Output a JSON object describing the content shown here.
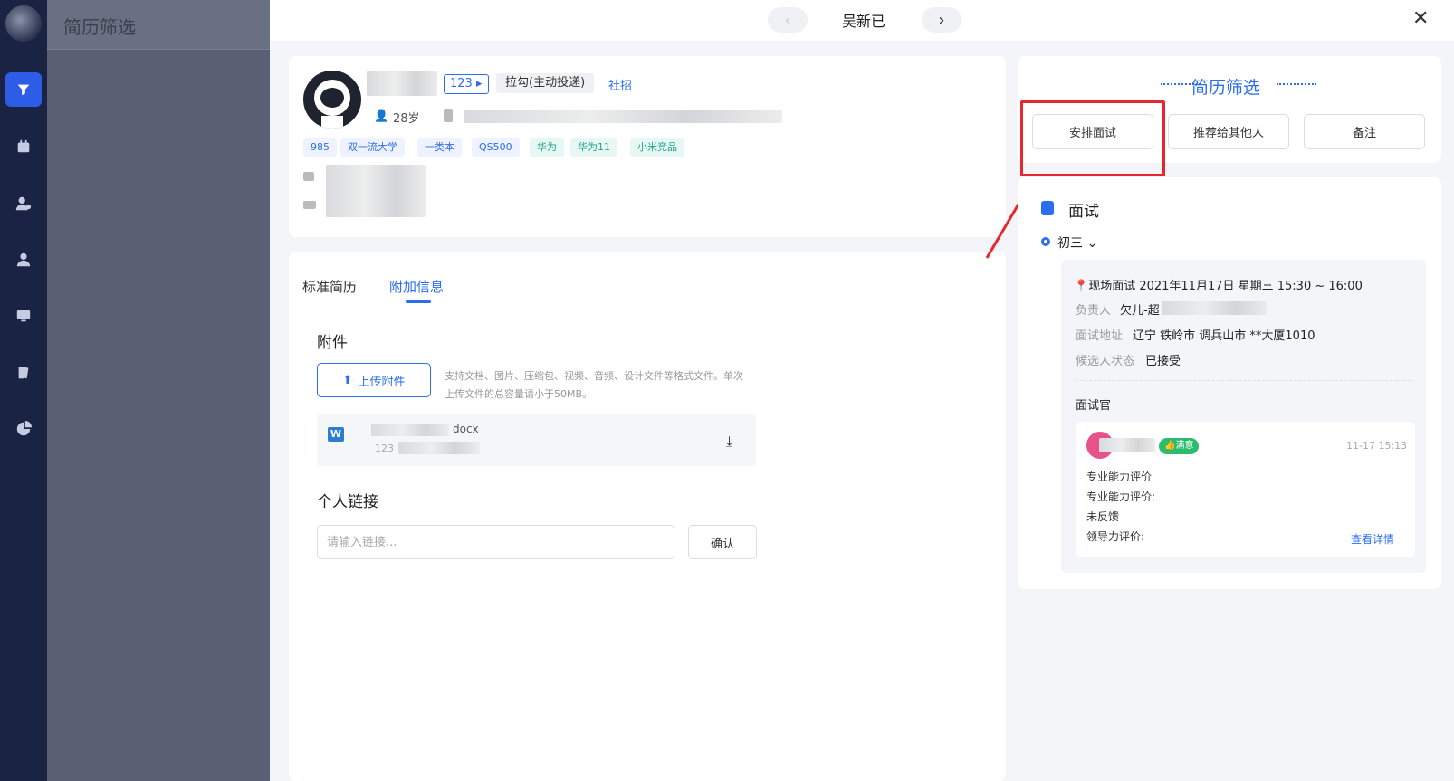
{
  "underlay": {
    "title": "简历筛选"
  },
  "header": {
    "candidate_name": "吴新已",
    "prev": "‹",
    "next": "›",
    "close": "✕"
  },
  "profile": {
    "id_tag": "123",
    "source": "拉勾(主动投递)",
    "type": "社招",
    "age": "28岁",
    "tags": [
      {
        "label": "985",
        "color": "blue"
      },
      {
        "label": "双一流大学",
        "color": "blue"
      },
      {
        "label": "一类本",
        "color": "blue"
      },
      {
        "label": "QS500",
        "color": "blue"
      },
      {
        "label": "华为",
        "color": "green"
      },
      {
        "label": "华为11",
        "color": "green"
      },
      {
        "label": "小米竞品",
        "color": "green"
      }
    ]
  },
  "tabs": [
    {
      "label": "标准简历"
    },
    {
      "label": "附加信息"
    }
  ],
  "attachments": {
    "title": "附件",
    "upload_label": "上传附件",
    "hint": "支持文档、图片、压缩包、视频、音频、设计文件等格式文件。单次上传文件的总容量请小于50MB。",
    "file_suffix": "docx",
    "file_size_prefix": "123"
  },
  "links": {
    "title": "个人链接",
    "placeholder": "请输入链接...",
    "confirm_label": "确认"
  },
  "right": {
    "title": "简历筛选",
    "actions": [
      {
        "label": "安排面试"
      },
      {
        "label": "推荐给其他人"
      },
      {
        "label": "备注"
      }
    ],
    "interview": {
      "title": "面试",
      "round": "初三",
      "summary": "现场面试 2021年11月17日 星期三 15:30 ~ 16:00",
      "owner_label": "负责人",
      "owner_value": "欠儿-超",
      "address_label": "面试地址",
      "address_value": "辽宁 铁岭市 调兵山市 **大厦1010",
      "status_label": "候选人状态",
      "status_value": "已接受",
      "interviewer_title": "面试官",
      "feedback": {
        "badge": "满意",
        "time": "11-17 15:13",
        "lines": [
          "专业能力评价",
          "专业能力评价:",
          "未反馈",
          "领导力评价:"
        ],
        "detail_link": "查看详情"
      }
    }
  }
}
